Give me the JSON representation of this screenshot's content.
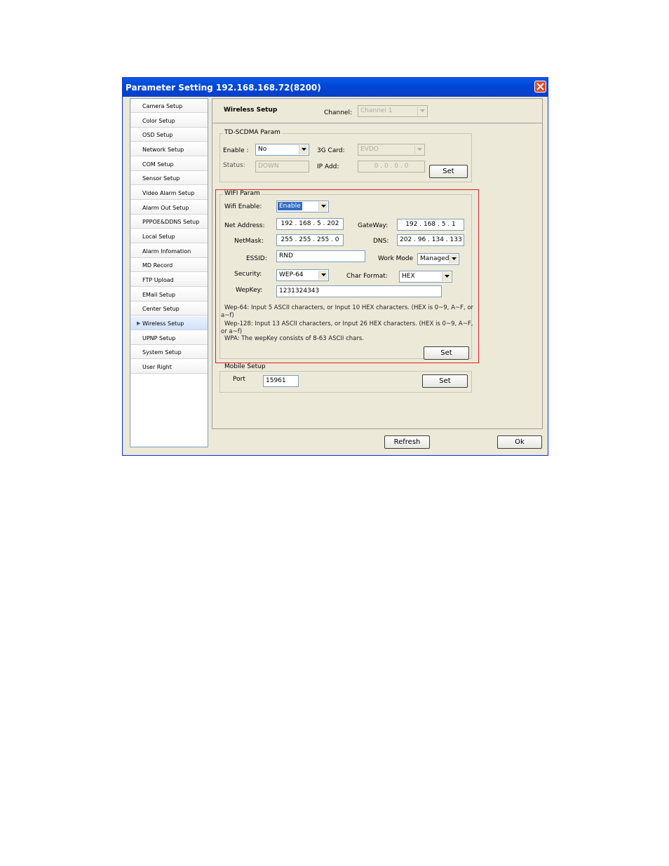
{
  "window": {
    "title": "Parameter Setting 192.168.168.72(8200)",
    "close_icon": "close-icon"
  },
  "sidebar": {
    "items": [
      {
        "label": "Camera Setup"
      },
      {
        "label": "Color Setup"
      },
      {
        "label": "OSD Setup"
      },
      {
        "label": "Network Setup"
      },
      {
        "label": "COM Setup"
      },
      {
        "label": "Sensor Setup"
      },
      {
        "label": "Video Alarm Setup"
      },
      {
        "label": "Alarm Out Setup"
      },
      {
        "label": "PPPOE&DDNS Setup"
      },
      {
        "label": "Local Setup"
      },
      {
        "label": "Alarm Infomation"
      },
      {
        "label": "MD Record"
      },
      {
        "label": "FTP Upload"
      },
      {
        "label": "EMail Setup"
      },
      {
        "label": "Center Setup"
      },
      {
        "label": "Wireless Setup"
      },
      {
        "label": "UPNP Setup"
      },
      {
        "label": "System Setup"
      },
      {
        "label": "User Right"
      }
    ],
    "active_index": 15
  },
  "main": {
    "heading": "Wireless Setup",
    "channel_label": "Channel:",
    "channel_value": "Channel 1"
  },
  "tdscdma": {
    "caption": "TD-SCDMA Param",
    "enable_label": "Enable :",
    "enable_value": "No",
    "card_label": "3G Card:",
    "card_value": "EVDO",
    "status_label": "Status:",
    "status_value": "DOWN",
    "ip_label": "IP Add:",
    "ip_value": "0 . 0 . 0 . 0",
    "set_label": "Set"
  },
  "wifi": {
    "caption": "WIFI Param",
    "enable_label": "Wifi Enable:",
    "enable_value": "Enable",
    "net_address_label": "Net Address:",
    "net_address_value": "192 . 168 . 5 . 202",
    "gateway_label": "GateWay:",
    "gateway_value": "192 . 168 . 5 . 1",
    "netmask_label": "NetMask:",
    "netmask_value": "255 . 255 . 255 . 0",
    "dns_label": "DNS:",
    "dns_value": "202 . 96 . 134 . 133",
    "essid_label": "ESSID:",
    "essid_value": "RND",
    "work_mode_label": "Work Mode",
    "work_mode_value": "Managed",
    "security_label": "Security:",
    "security_value": "WEP-64",
    "char_format_label": "Char Format:",
    "char_format_value": "HEX",
    "wepkey_label": "WepKey:",
    "wepkey_value": "1231324343",
    "notes": [
      "Wep-64: Input 5 ASCII characters, or Input 10 HEX characters. (HEX is 0~9, A~F, or",
      "a~f)",
      "Wep-128: Input 13 ASCII characters, or Input 26 HEX characters. (HEX is 0~9, A~F,",
      "or a~f)",
      "WPA: The wepKey consists of 8-63 ASCII chars."
    ],
    "set_label": "Set"
  },
  "mobile": {
    "caption": "Mobile Setup",
    "port_label": "Port",
    "port_value": "15961",
    "set_label": "Set"
  },
  "footer": {
    "refresh_label": "Refresh",
    "ok_label": "Ok"
  },
  "colors": {
    "titlebar": "#0046d5",
    "highlight_border": "#e02020",
    "selection": "#316ac5"
  }
}
